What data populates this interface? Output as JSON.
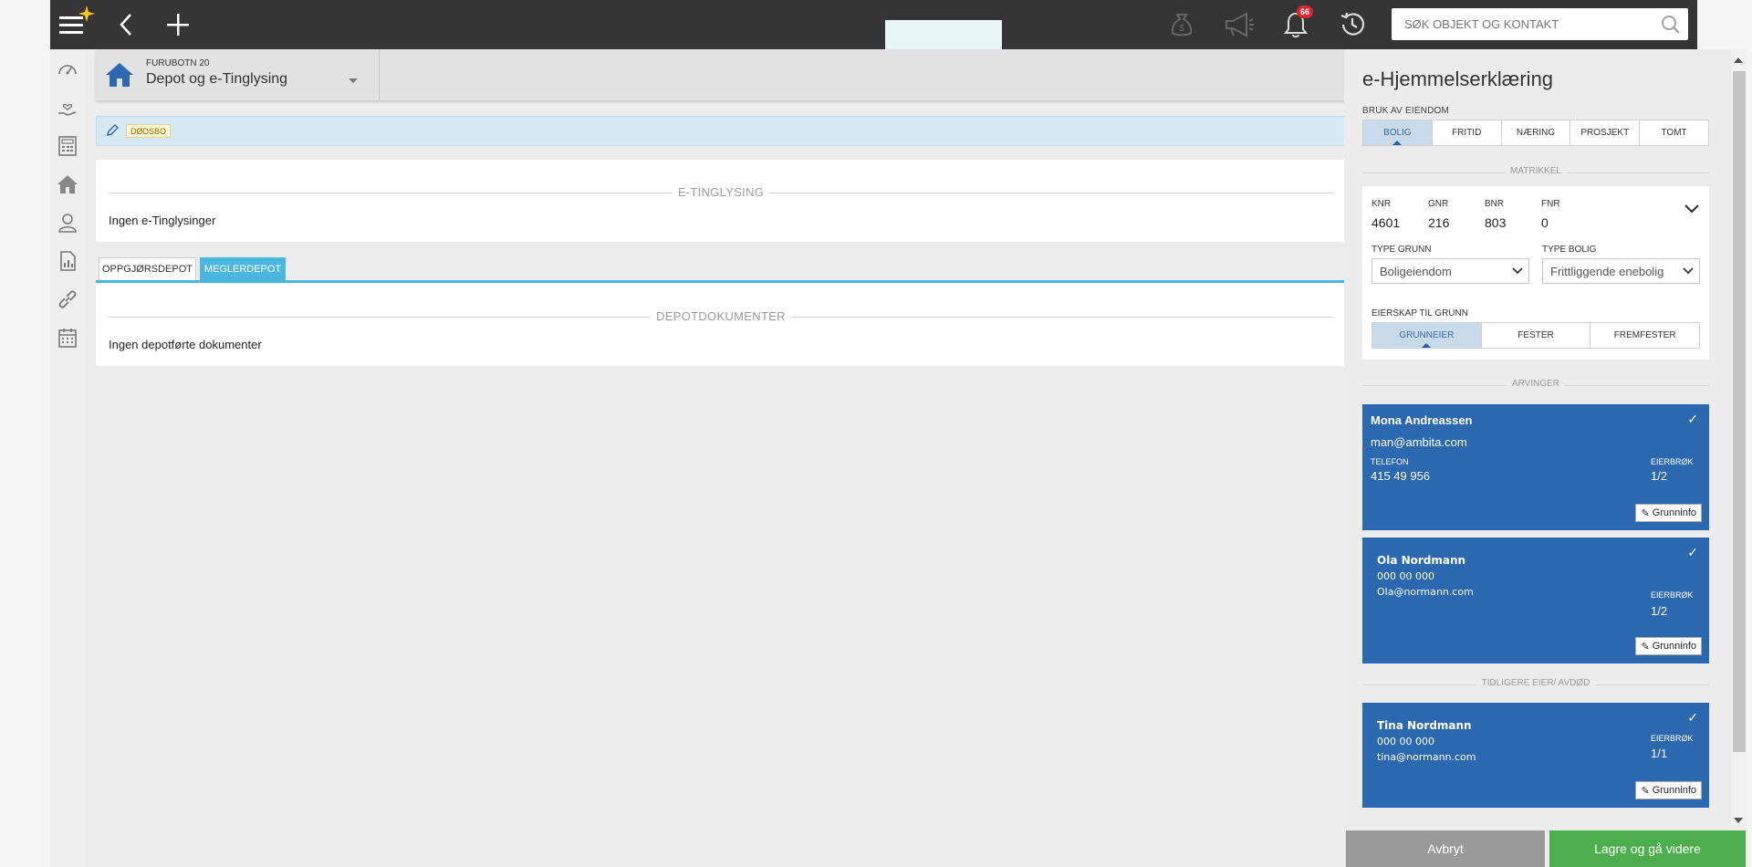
{
  "topbar": {
    "search_placeholder": "SØK OBJEKT OG KONTAKT",
    "notification_count": "66",
    "icons": [
      "menu-icon",
      "sparkle-icon",
      "back-icon",
      "add-icon",
      "money-bag-icon",
      "megaphone-icon",
      "bell-icon",
      "history-icon",
      "search-icon"
    ]
  },
  "sidebar": {
    "icons": [
      "dashboard-icon",
      "hand-heart-icon",
      "calculator-icon",
      "home-icon",
      "person-icon",
      "report-icon",
      "link-icon",
      "calendar-icon"
    ]
  },
  "header": {
    "subtitle": "FURUBOTN 20",
    "title": "Depot og e-Tinglysing"
  },
  "infobar": {
    "badge": "DØDSBO"
  },
  "tinglysing": {
    "section_label": "E-TINGLYSING",
    "empty_text": "Ingen e-Tinglysinger"
  },
  "tabs": [
    {
      "label": "OPPGJØRSDEPOT",
      "active": false
    },
    {
      "label": "MEGLERDEPOT",
      "active": true
    }
  ],
  "depot": {
    "section_label": "DEPOTDOKUMENTER",
    "empty_text": "Ingen depotførte dokumenter"
  },
  "panel": {
    "title": "e-Hjemmelserklæring",
    "usage_label": "BRUK AV EIENDOM",
    "usage_options": [
      "BOLIG",
      "FRITID",
      "NÆRING",
      "PROSJEKT",
      "TOMT"
    ],
    "usage_selected": "BOLIG",
    "matrikkel_label": "MATRIKKEL",
    "matrikkel": {
      "knr_label": "KNR",
      "knr": "4601",
      "gnr_label": "GNR",
      "gnr": "216",
      "bnr_label": "BNR",
      "bnr": "803",
      "fnr_label": "FNR",
      "fnr": "0"
    },
    "type_grunn_label": "TYPE GRUNN",
    "type_grunn_value": "Boligeiendom",
    "type_bolig_label": "TYPE BOLIG",
    "type_bolig_value": "Frittliggende enebolig",
    "eierskap_label": "EIERSKAP TIL GRUNN",
    "eierskap_options": [
      "GRUNNEIER",
      "FESTER",
      "FREMFESTER"
    ],
    "eierskap_selected": "GRUNNEIER",
    "arvinger_label": "ARVINGER",
    "heirs": [
      {
        "name": "Mona Andreassen",
        "email": "man@ambita.com",
        "phone_label": "TELEFON",
        "phone": "415 49 956",
        "share_label": "EIERBRØK",
        "share": "1/2",
        "button": "Grunninfo"
      },
      {
        "name": "Ola Nordmann",
        "phone": "000 00 000",
        "email": "Ola@normann.com",
        "share_label": "EIERBRØK",
        "share": "1/2",
        "button": "Grunninfo"
      }
    ],
    "previous_label": "TIDLIGERE EIER/ AVDØD",
    "previous_owner": {
      "name": "Tina Nordmann",
      "phone": "000 00 000",
      "email": "tina@normann.com",
      "share_label": "EIERBRØK",
      "share": "1/1",
      "button": "Grunninfo"
    },
    "cancel_label": "Avbryt",
    "save_label": "Lagre og gå videre"
  },
  "colors": {
    "topbar": "#353535",
    "accent_blue": "#2b68b0",
    "tab_active": "#4bb6de",
    "save_green": "#4cae4c",
    "cancel_gray": "#9a9a9a",
    "badge_red": "#d9262f"
  }
}
